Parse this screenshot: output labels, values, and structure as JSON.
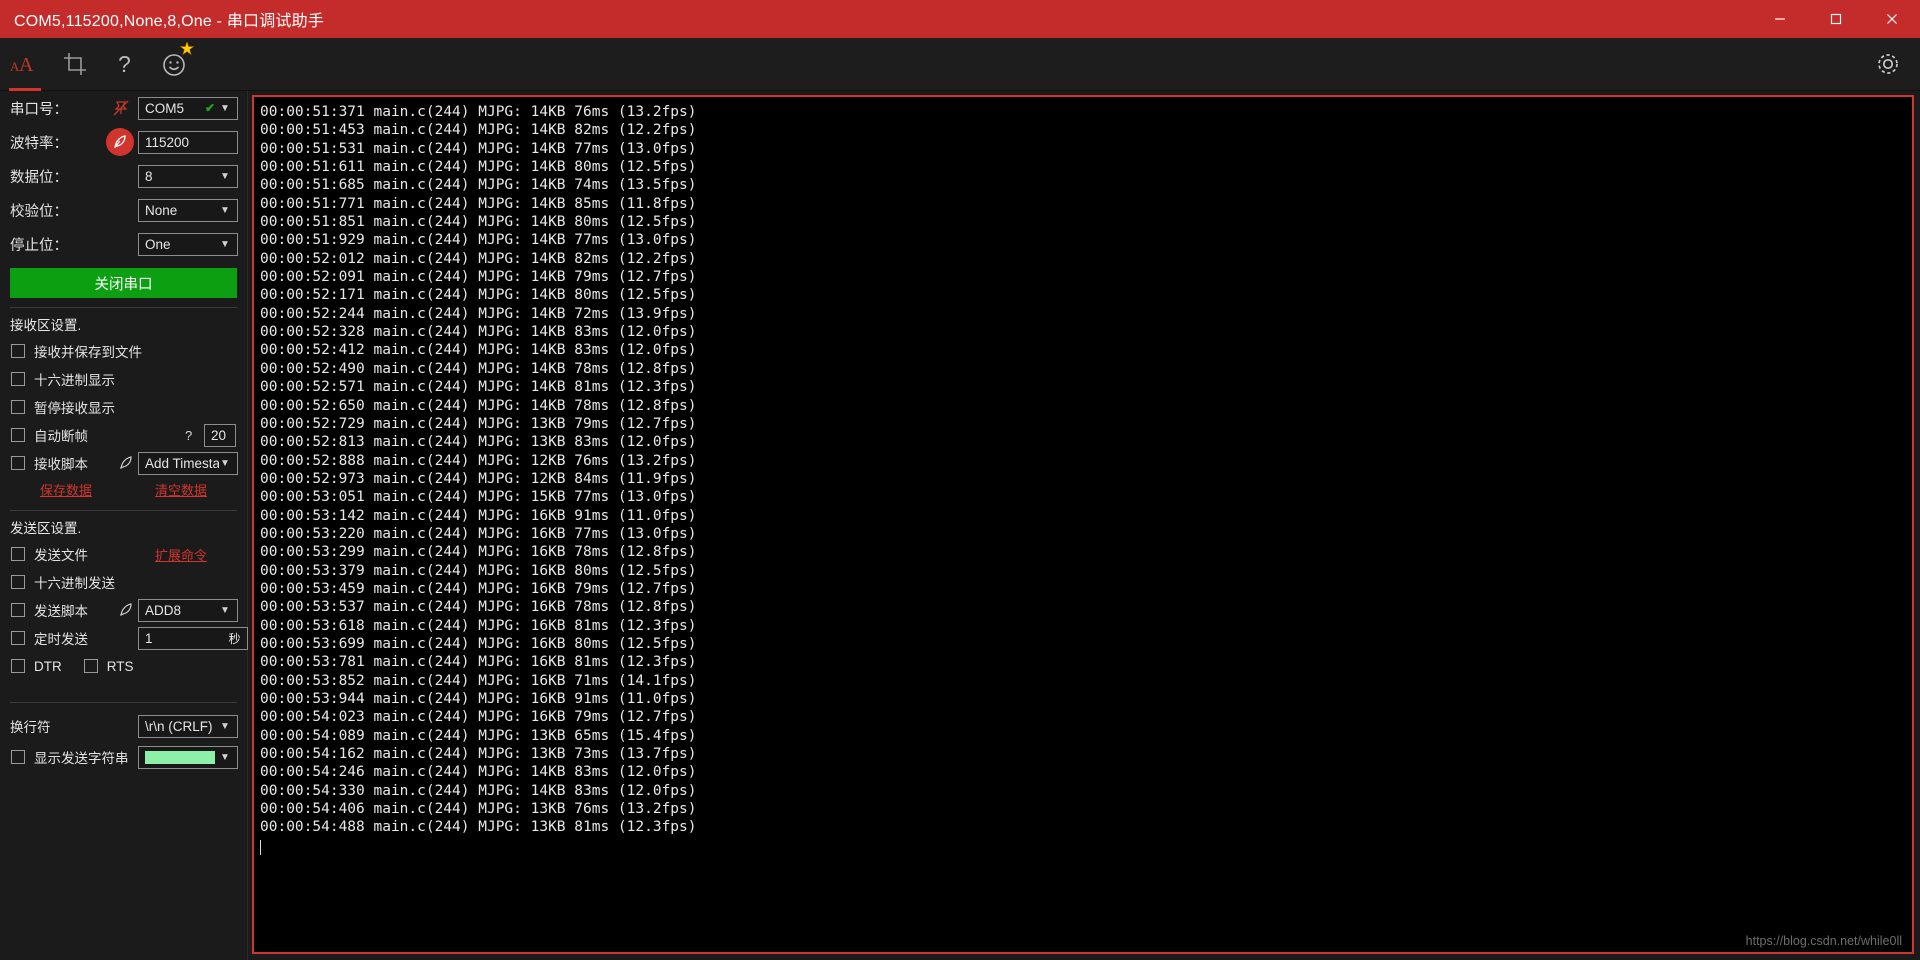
{
  "window": {
    "title": "COM5,115200,None,8,One - 串口调试助手",
    "minimize": "–",
    "maximize": "▢",
    "close": "✕"
  },
  "toolbar": {
    "font_icon": "font-size-icon",
    "crop_icon": "crop-icon",
    "help_icon": "question-mark-icon",
    "smiley_icon": "smiley-icon",
    "gear_icon": "gear-icon"
  },
  "sidebar": {
    "port_label": "串口号：",
    "port_value": "COM5",
    "baud_label": "波特率：",
    "baud_value": "115200",
    "databits_label": "数据位：",
    "databits_value": "8",
    "parity_label": "校验位：",
    "parity_value": "None",
    "stopbits_label": "停止位：",
    "stopbits_value": "One",
    "open_close_button": "关闭串口",
    "recv_section": "接收区设置.",
    "recv_save_file": "接收并保存到文件",
    "recv_hex_display": "十六进制显示",
    "recv_pause_display": "暂停接收显示",
    "recv_auto_frame": "自动断帧",
    "recv_auto_frame_help": "?",
    "recv_auto_frame_value": "20",
    "recv_script": "接收脚本",
    "recv_script_value": "Add Timesta",
    "save_data_link": "保存数据",
    "clear_data_link": "清空数据",
    "send_section": "发送区设置.",
    "send_file": "发送文件",
    "extend_cmd_link": "扩展命令",
    "send_hex": "十六进制发送",
    "send_script": "发送脚本",
    "send_script_value": "ADD8",
    "send_timed": "定时发送",
    "send_timed_value": "1",
    "send_timed_unit": "秒",
    "dtr": "DTR",
    "rts": "RTS",
    "newline_label": "换行符",
    "newline_value": "\\r\\n (CRLF)",
    "show_send_string": "显示发送字符串",
    "show_send_color": "#8cf0a8"
  },
  "terminal": {
    "watermark": "https://blog.csdn.net/while0ll",
    "lines": [
      "00:00:51:371 main.c(244) MJPG: 14KB 76ms (13.2fps)",
      "00:00:51:453 main.c(244) MJPG: 14KB 82ms (12.2fps)",
      "00:00:51:531 main.c(244) MJPG: 14KB 77ms (13.0fps)",
      "00:00:51:611 main.c(244) MJPG: 14KB 80ms (12.5fps)",
      "00:00:51:685 main.c(244) MJPG: 14KB 74ms (13.5fps)",
      "00:00:51:771 main.c(244) MJPG: 14KB 85ms (11.8fps)",
      "00:00:51:851 main.c(244) MJPG: 14KB 80ms (12.5fps)",
      "00:00:51:929 main.c(244) MJPG: 14KB 77ms (13.0fps)",
      "00:00:52:012 main.c(244) MJPG: 14KB 82ms (12.2fps)",
      "00:00:52:091 main.c(244) MJPG: 14KB 79ms (12.7fps)",
      "00:00:52:171 main.c(244) MJPG: 14KB 80ms (12.5fps)",
      "00:00:52:244 main.c(244) MJPG: 14KB 72ms (13.9fps)",
      "00:00:52:328 main.c(244) MJPG: 14KB 83ms (12.0fps)",
      "00:00:52:412 main.c(244) MJPG: 14KB 83ms (12.0fps)",
      "00:00:52:490 main.c(244) MJPG: 14KB 78ms (12.8fps)",
      "00:00:52:571 main.c(244) MJPG: 14KB 81ms (12.3fps)",
      "00:00:52:650 main.c(244) MJPG: 14KB 78ms (12.8fps)",
      "00:00:52:729 main.c(244) MJPG: 13KB 79ms (12.7fps)",
      "00:00:52:813 main.c(244) MJPG: 13KB 83ms (12.0fps)",
      "00:00:52:888 main.c(244) MJPG: 12KB 76ms (13.2fps)",
      "00:00:52:973 main.c(244) MJPG: 12KB 84ms (11.9fps)",
      "00:00:53:051 main.c(244) MJPG: 15KB 77ms (13.0fps)",
      "00:00:53:142 main.c(244) MJPG: 16KB 91ms (11.0fps)",
      "00:00:53:220 main.c(244) MJPG: 16KB 77ms (13.0fps)",
      "00:00:53:299 main.c(244) MJPG: 16KB 78ms (12.8fps)",
      "00:00:53:379 main.c(244) MJPG: 16KB 80ms (12.5fps)",
      "00:00:53:459 main.c(244) MJPG: 16KB 79ms (12.7fps)",
      "00:00:53:537 main.c(244) MJPG: 16KB 78ms (12.8fps)",
      "00:00:53:618 main.c(244) MJPG: 16KB 81ms (12.3fps)",
      "00:00:53:699 main.c(244) MJPG: 16KB 80ms (12.5fps)",
      "00:00:53:781 main.c(244) MJPG: 16KB 81ms (12.3fps)",
      "00:00:53:852 main.c(244) MJPG: 16KB 71ms (14.1fps)",
      "00:00:53:944 main.c(244) MJPG: 16KB 91ms (11.0fps)",
      "00:00:54:023 main.c(244) MJPG: 16KB 79ms (12.7fps)",
      "00:00:54:089 main.c(244) MJPG: 13KB 65ms (15.4fps)",
      "00:00:54:162 main.c(244) MJPG: 13KB 73ms (13.7fps)",
      "00:00:54:246 main.c(244) MJPG: 14KB 83ms (12.0fps)",
      "00:00:54:330 main.c(244) MJPG: 14KB 83ms (12.0fps)",
      "00:00:54:406 main.c(244) MJPG: 13KB 76ms (13.2fps)",
      "00:00:54:488 main.c(244) MJPG: 13KB 81ms (12.3fps)"
    ]
  }
}
